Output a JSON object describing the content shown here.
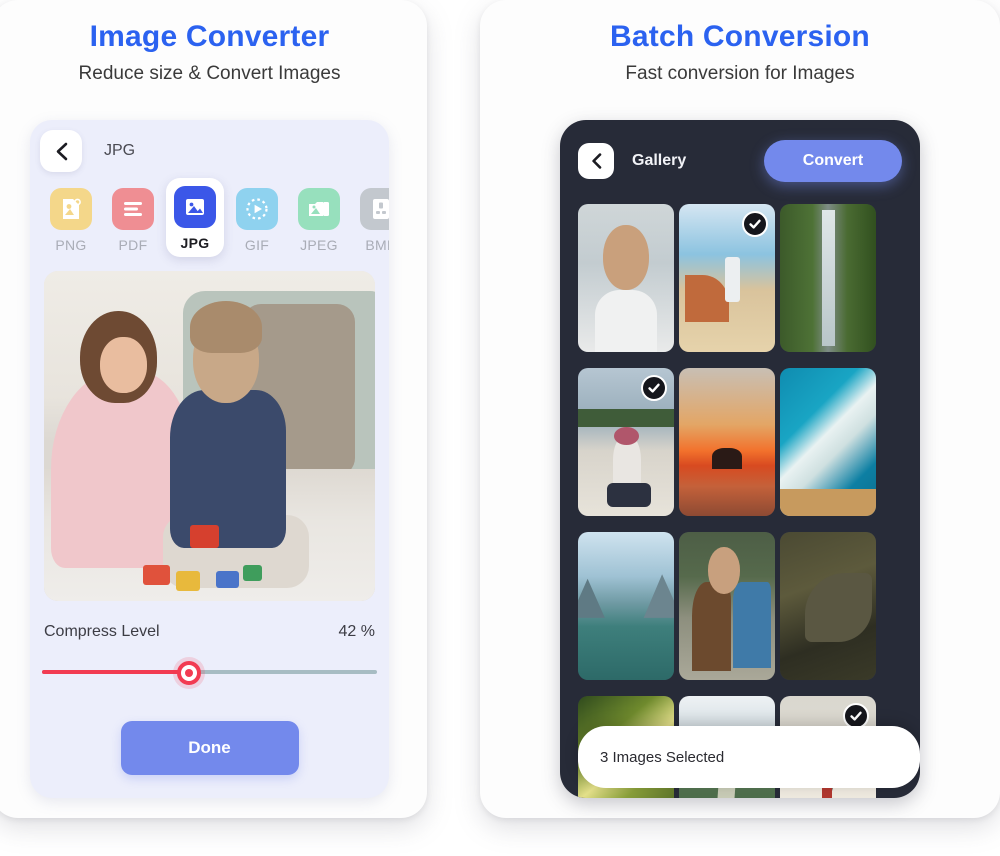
{
  "left_panel": {
    "title": "Image Converter",
    "subtitle": "Reduce size & Convert Images",
    "phone": {
      "back_icon": "chevron-left-icon",
      "format_label": "JPG",
      "formats": [
        {
          "label": "PNG",
          "icon": "image-file-icon",
          "color": "#f4d78a",
          "active": false
        },
        {
          "label": "PDF",
          "icon": "document-lines-icon",
          "color": "#ef8e93",
          "active": false
        },
        {
          "label": "JPG",
          "icon": "picture-icon",
          "color": "#3b57e8",
          "active": true
        },
        {
          "label": "GIF",
          "icon": "play-circle-icon",
          "color": "#8fd2ef",
          "active": false
        },
        {
          "label": "JPEG",
          "icon": "photo-frame-icon",
          "color": "#97e0bd",
          "active": false
        },
        {
          "label": "BMP",
          "icon": "contact-card-icon",
          "color": "#c3c8ce",
          "active": false
        }
      ],
      "preview_alt": "mother-and-child-playing-photo",
      "compress": {
        "label": "Compress Level",
        "value_text": "42 %",
        "value": 42,
        "track_color": "#a7bcc3",
        "fill_color": "#f23b52"
      },
      "done_label": "Done",
      "done_color": "#7389ec"
    }
  },
  "right_panel": {
    "title": "Batch Conversion",
    "subtitle": "Fast conversion for Images",
    "phone": {
      "back_icon": "chevron-left-icon",
      "header_title": "Gallery",
      "convert_label": "Convert",
      "convert_color": "#7389ec",
      "background": "#272b38",
      "gallery": [
        {
          "alt": "woman-portrait",
          "art": "a-portrait",
          "selected": false
        },
        {
          "alt": "lighthouse-beach",
          "art": "a-light",
          "selected": true
        },
        {
          "alt": "waterfall-forest",
          "art": "a-fall",
          "selected": false
        },
        {
          "alt": "woman-sitting-lake",
          "art": "a-lake",
          "selected": true
        },
        {
          "alt": "sunset-over-water",
          "art": "a-sunset",
          "selected": false
        },
        {
          "alt": "ocean-wave-aerial",
          "art": "a-wave",
          "selected": false
        },
        {
          "alt": "mountain-lake",
          "art": "a-mtn",
          "selected": false
        },
        {
          "alt": "couple-outdoors",
          "art": "a-couple",
          "selected": false
        },
        {
          "alt": "butterfly-closeup",
          "art": "a-butterfly",
          "selected": false
        },
        {
          "alt": "sun-through-trees",
          "art": "a-forest",
          "selected": false
        },
        {
          "alt": "mountain-road",
          "art": "a-road",
          "selected": false
        },
        {
          "alt": "person-on-beach",
          "art": "a-beach",
          "selected": true
        }
      ],
      "status_bar": {
        "text": "3 Images Selected",
        "count": 3
      }
    }
  },
  "theme": {
    "accent_blue": "#2b62f0",
    "button_blue": "#7389ec",
    "page_background": "#ffffff",
    "card_background": "#fdfdfd",
    "light_phone_background": "#eceefb",
    "dark_phone_background": "#272b38"
  }
}
